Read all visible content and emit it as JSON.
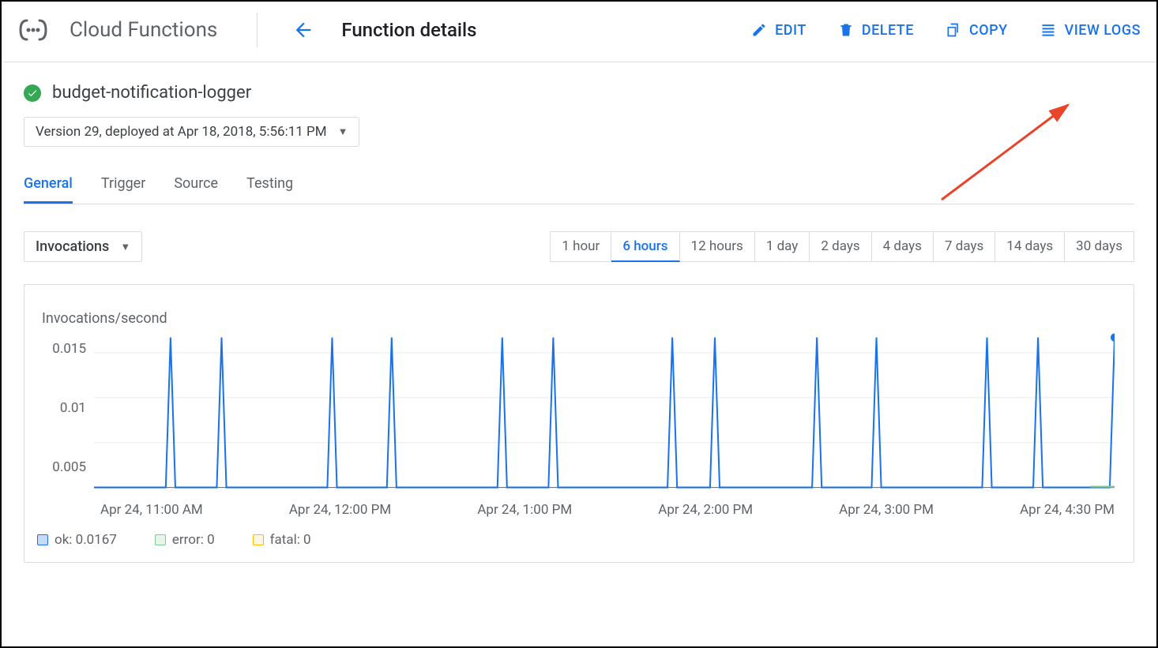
{
  "header": {
    "product": "Cloud Functions",
    "title": "Function details",
    "actions": {
      "edit": "EDIT",
      "delete": "DELETE",
      "copy": "COPY",
      "view_logs": "VIEW LOGS"
    }
  },
  "function": {
    "name": "budget-notification-logger",
    "version_label": "Version 29, deployed at Apr 18, 2018, 5:56:11 PM"
  },
  "tabs": [
    "General",
    "Trigger",
    "Source",
    "Testing"
  ],
  "active_tab": "General",
  "metric_select": "Invocations",
  "time_ranges": [
    "1 hour",
    "6 hours",
    "12 hours",
    "1 day",
    "2 days",
    "4 days",
    "7 days",
    "14 days",
    "30 days"
  ],
  "active_range": "6 hours",
  "chart": {
    "title": "Invocations/second",
    "y_ticks": [
      "0.015",
      "0.01",
      "0.005"
    ],
    "x_ticks": [
      "Apr 24, 11:00 AM",
      "Apr 24, 12:00 PM",
      "Apr 24, 1:00 PM",
      "Apr 24, 2:00 PM",
      "Apr 24, 3:00 PM",
      "Apr 24, 4:30 PM"
    ]
  },
  "legend": {
    "ok": "ok: 0.0167",
    "error": "error: 0",
    "fatal": "fatal: 0"
  },
  "chart_data": {
    "type": "line",
    "title": "Invocations/second",
    "xlabel": "",
    "ylabel": "Invocations/second",
    "ylim": [
      0,
      0.017
    ],
    "x_range": [
      "2018-04-24T10:30:00",
      "2018-04-24T16:30:00"
    ],
    "series": [
      {
        "name": "ok",
        "color": "#1a73e8",
        "spikes_at": [
          "2018-04-24T10:57:00",
          "2018-04-24T11:15:00",
          "2018-04-24T11:54:00",
          "2018-04-24T12:15:00",
          "2018-04-24T12:54:00",
          "2018-04-24T13:12:00",
          "2018-04-24T13:54:00",
          "2018-04-24T14:09:00",
          "2018-04-24T14:45:00",
          "2018-04-24T15:06:00",
          "2018-04-24T15:45:00",
          "2018-04-24T16:03:00",
          "2018-04-24T16:30:00"
        ],
        "spike_value": 0.0167,
        "baseline": 0
      },
      {
        "name": "error",
        "color": "#81c995",
        "constant": 0
      },
      {
        "name": "fatal",
        "color": "#fbbc04",
        "constant": 0
      }
    ]
  }
}
